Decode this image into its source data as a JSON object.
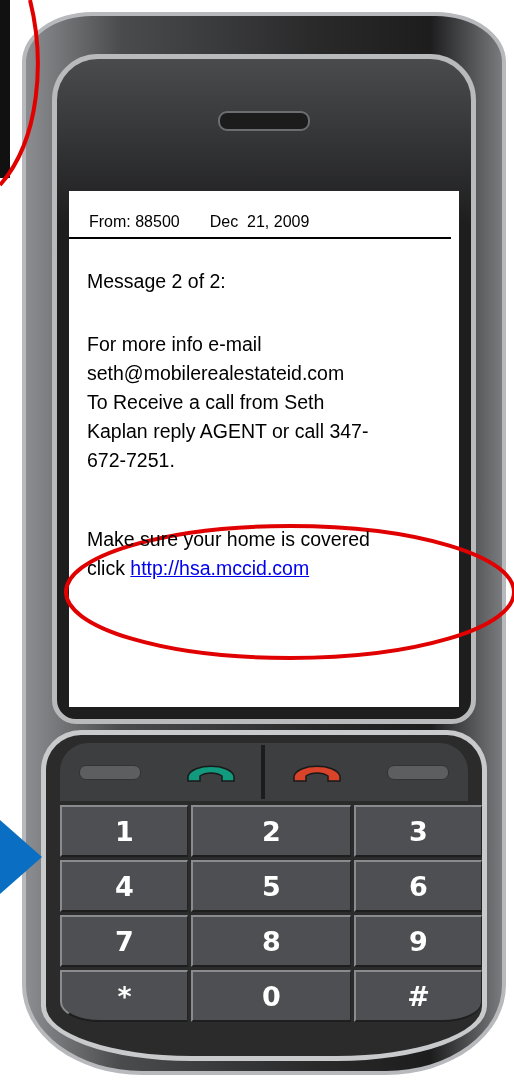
{
  "message": {
    "from": "From: 88500",
    "date": "Dec  21, 2009",
    "header": "Message 2 of 2:",
    "paragraphs": [
      [
        "For more info e-mail",
        "seth@mobilerealestateid.com",
        "To Receive a call from Seth",
        "Kaplan reply AGENT or call 347-",
        "672-7251."
      ]
    ],
    "closing": "Make sure your home is covered",
    "closing_prefix": "click",
    "link": "http://hsa.mccid.com"
  },
  "keypad": {
    "keys": [
      "1",
      "2",
      "3",
      "4",
      "5",
      "6",
      "7",
      "8",
      "9",
      "*",
      "0",
      "#"
    ]
  }
}
